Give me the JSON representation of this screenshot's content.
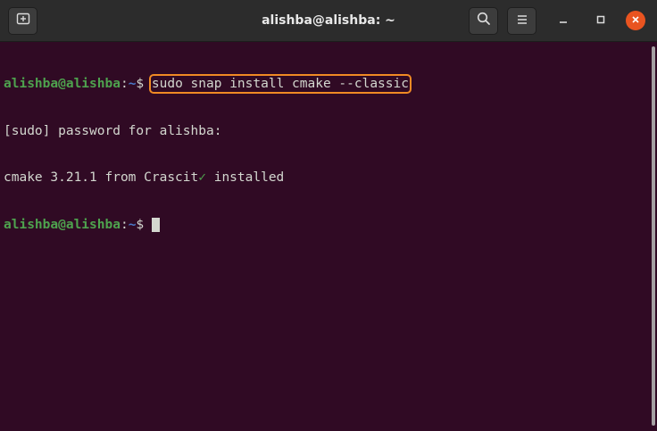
{
  "window": {
    "title": "alishba@alishba: ~",
    "new_tab_icon": "new-tab-icon",
    "search_icon": "search-icon",
    "menu_icon": "hamburger-menu-icon",
    "minimize_icon": "minimize-icon",
    "maximize_icon": "maximize-icon",
    "close_icon": "close-icon",
    "close_color": "#e95420"
  },
  "terminal": {
    "background": "#300a24",
    "lines": [
      {
        "user": "alishba@alishba",
        "sep": ":",
        "path": "~",
        "dollar": "$ ",
        "command": "sudo snap install cmake --classic"
      },
      {
        "text": "[sudo] password for alishba:"
      },
      {
        "text_before": "cmake 3.21.1 from Crascit",
        "check": "✓",
        "text_after": " installed"
      },
      {
        "user": "alishba@alishba",
        "sep": ":",
        "path": "~",
        "dollar": "$ "
      }
    ],
    "highlight_color": "#f08a24"
  }
}
